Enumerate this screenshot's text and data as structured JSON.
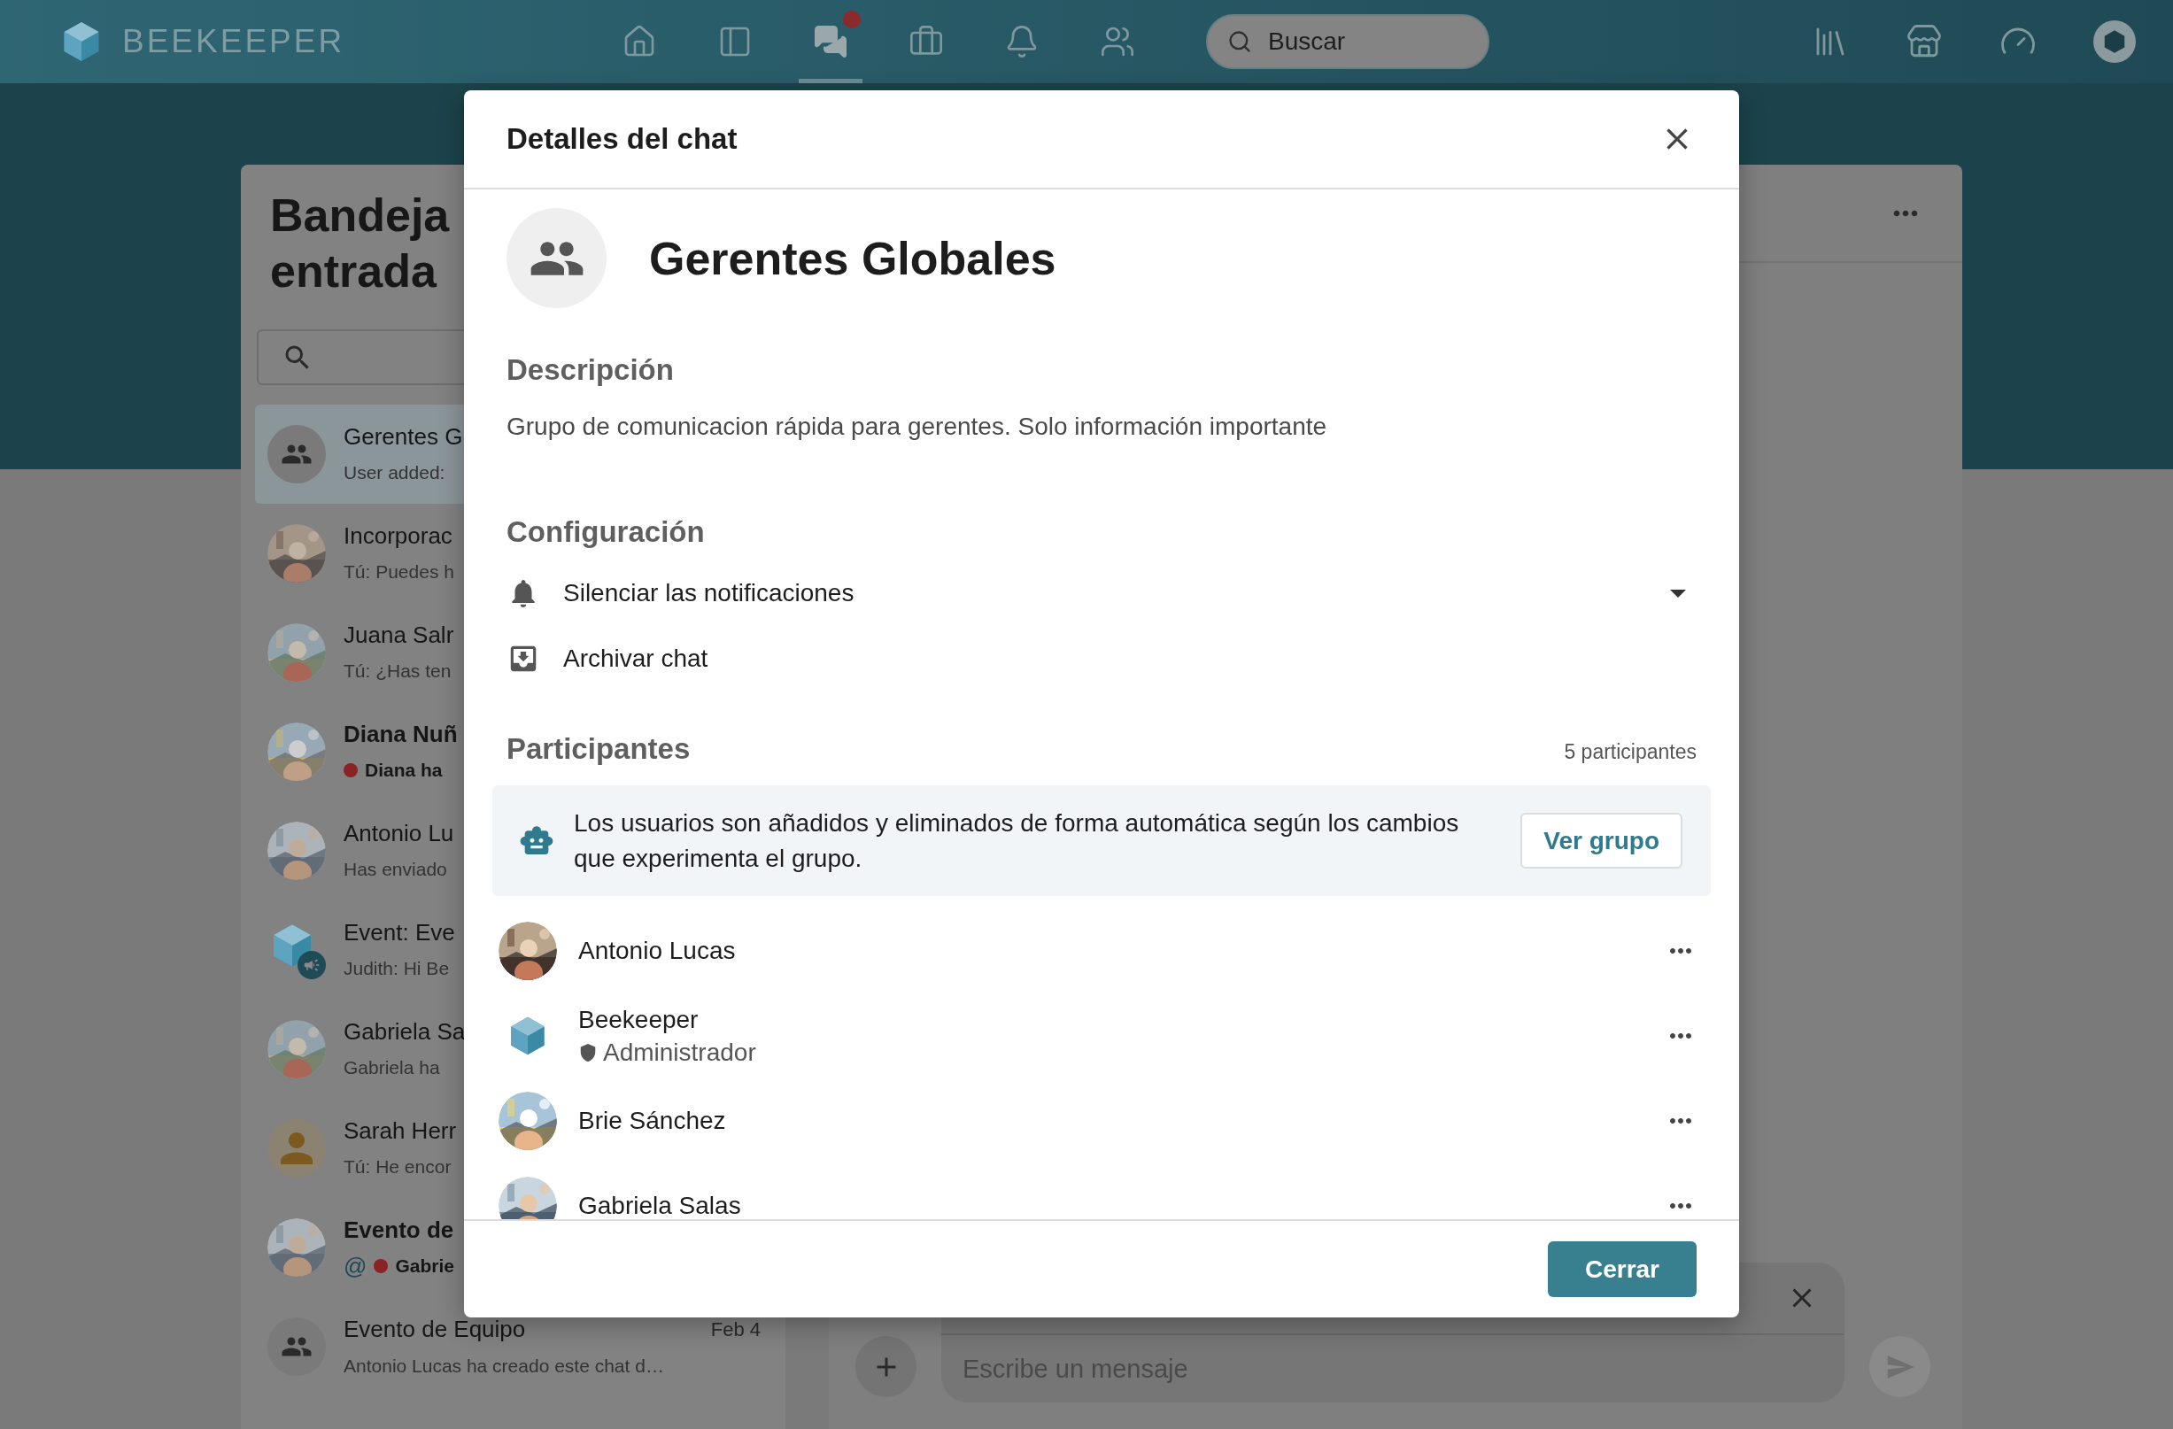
{
  "app_bar": {
    "brand": "BEEKEEPER",
    "nav": [
      {
        "selected": false,
        "alert": false
      },
      {
        "selected": false,
        "alert": false
      },
      {
        "selected": true,
        "alert": true
      },
      {
        "selected": false,
        "alert": false
      },
      {
        "selected": false,
        "alert": false
      },
      {
        "selected": false,
        "alert": false
      }
    ],
    "search": {
      "placeholder": "Buscar"
    }
  },
  "inbox": {
    "title_lines": [
      "Bandeja",
      "entrada"
    ],
    "items": [
      {
        "name": "Gerentes G",
        "preview": "User added:",
        "kind": "group",
        "selected": true,
        "unread": false,
        "mention": false
      },
      {
        "name": "Incorporac",
        "preview": "Tú: Puedes h",
        "kind": "picture",
        "selected": false,
        "unread": false,
        "mention": false
      },
      {
        "name": "Juana Salr",
        "preview": "Tú: ¿Has ten",
        "kind": "picture",
        "selected": false,
        "unread": false,
        "mention": false
      },
      {
        "name": "Diana Nuñ",
        "preview": "Diana ha",
        "kind": "picture",
        "selected": false,
        "unread": true,
        "mention": false
      },
      {
        "name": "Antonio Lu",
        "preview": "Has enviado",
        "kind": "picture",
        "selected": false,
        "unread": false,
        "mention": false
      },
      {
        "name": "Event: Eve",
        "preview": "Judith: Hi Be",
        "kind": "event",
        "selected": false,
        "unread": false,
        "mention": false
      },
      {
        "name": "Gabriela Sa",
        "preview": "Gabriela ha",
        "kind": "picture",
        "selected": false,
        "unread": false,
        "mention": false
      },
      {
        "name": "Sarah Herr",
        "preview": "Tú: He encor",
        "kind": "person",
        "selected": false,
        "unread": false,
        "mention": false
      },
      {
        "name": "Evento de",
        "preview": "Gabrie",
        "kind": "picture",
        "selected": false,
        "unread": true,
        "mention": true,
        "mention_mark": "@"
      },
      {
        "name": "Evento de Equipo",
        "preview": "Antonio Lucas ha creado este chat d…",
        "time": "Feb 4",
        "kind": "group",
        "selected": false,
        "unread": false,
        "mention": false
      }
    ]
  },
  "chat": {
    "message_placeholder": "Escribe un mensaje"
  },
  "modal": {
    "title": "Detalles del chat",
    "group_name": "Gerentes Globales",
    "description_heading": "Descripción",
    "description": "Grupo de comunicacion rápida para gerentes. Solo información importante",
    "settings_heading": "Configuración",
    "settings": [
      {
        "kind": "dropdown",
        "label": "Silenciar las notificaciones"
      },
      {
        "kind": "action",
        "label": "Archivar chat"
      }
    ],
    "participants_heading": "Participantes",
    "participants_count": "5 participantes",
    "notice": {
      "text": "Los usuarios son añadidos y eliminados de forma automática según los cambios que experimenta el grupo.",
      "button": "Ver grupo"
    },
    "participants": [
      {
        "name": "Antonio Lucas",
        "kind": "picture"
      },
      {
        "name": "Beekeeper",
        "role": "Administrador",
        "kind": "brand"
      },
      {
        "name": "Brie Sánchez",
        "kind": "picture"
      },
      {
        "name": "Gabriela Salas",
        "kind": "picture"
      }
    ],
    "close_button": "Cerrar"
  }
}
